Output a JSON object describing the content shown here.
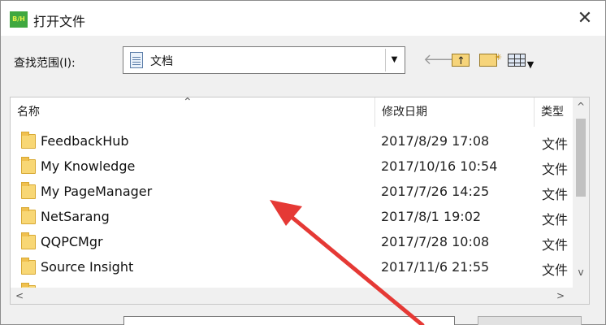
{
  "window": {
    "app_icon_text": "B/H",
    "title": "打开文件",
    "close_glyph": "✕"
  },
  "lookin": {
    "label": "查找范围(I):",
    "value": "文档",
    "dropdown_glyph": "▼"
  },
  "toolbar": {
    "back_glyph": "🡐",
    "view_caret": "▼"
  },
  "list": {
    "sort_glyph": "⌃",
    "columns": {
      "name": "名称",
      "date": "修改日期",
      "type": "类型"
    },
    "rows": [
      {
        "name": "FeedbackHub",
        "date": "2017/8/29 17:08",
        "type": "文件"
      },
      {
        "name": "My Knowledge",
        "date": "2017/10/16 10:54",
        "type": "文件"
      },
      {
        "name": "My PageManager",
        "date": "2017/7/26 14:25",
        "type": "文件"
      },
      {
        "name": "NetSarang",
        "date": "2017/8/1 19:02",
        "type": "文件"
      },
      {
        "name": "QQPCMgr",
        "date": "2017/7/28 10:08",
        "type": "文件"
      },
      {
        "name": "Source Insight",
        "date": "2017/11/6 21:55",
        "type": "文件"
      },
      {
        "name": "",
        "date": "",
        "type": ""
      }
    ],
    "scroll": {
      "up": "^",
      "down": "v",
      "left": "<",
      "right": ">"
    }
  },
  "filename": {
    "label": "",
    "value": ""
  },
  "colors": {
    "annotation_arrow": "#e53935",
    "folder": "#f8d775",
    "app_icon": "#3fa83f"
  }
}
